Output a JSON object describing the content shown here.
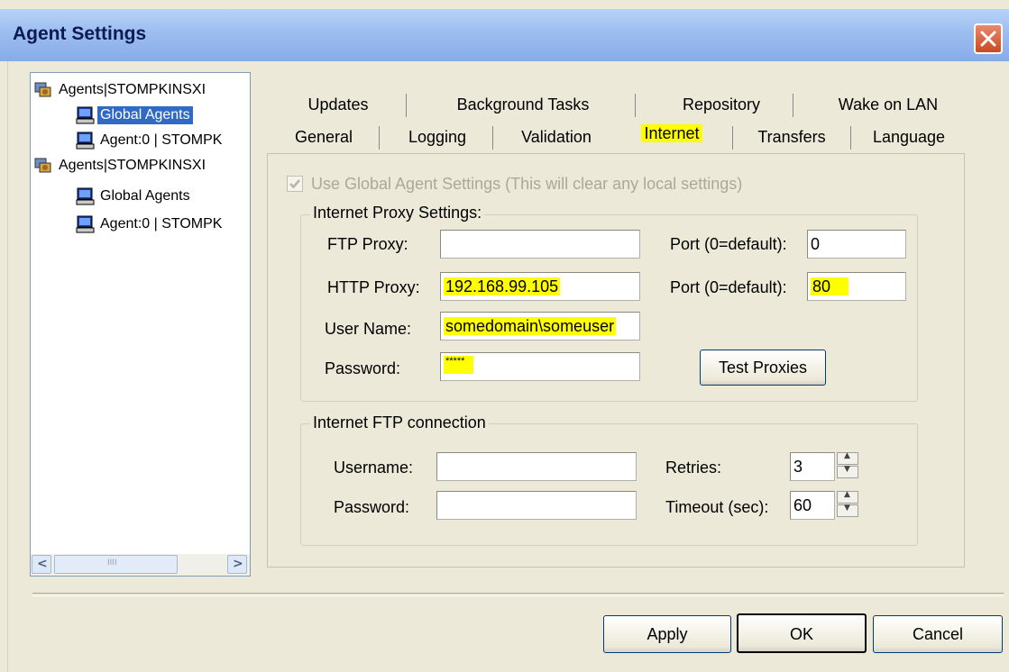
{
  "window": {
    "title": "Agent Settings",
    "close_icon": "close-icon"
  },
  "tree": {
    "nodes": [
      {
        "label": "Agents|STOMPKINSXI",
        "icon": "agents-group-icon",
        "level": 0,
        "selected": false
      },
      {
        "label": "Global Agents",
        "icon": "computer-icon",
        "level": 1,
        "selected": true
      },
      {
        "label": "Agent:0 | STOMPK",
        "icon": "computer-icon",
        "level": 1,
        "selected": false
      },
      {
        "label": "Agents|STOMPKINSXI",
        "icon": "agents-group-icon",
        "level": 0,
        "selected": false
      },
      {
        "label": "Global Agents",
        "icon": "computer-icon",
        "level": 1,
        "selected": false
      },
      {
        "label": "Agent:0 | STOMPK",
        "icon": "computer-icon",
        "level": 1,
        "selected": false
      }
    ],
    "scroll_left": "<",
    "scroll_right": ">",
    "scroll_thumb": "IIII"
  },
  "tabs": {
    "row1": [
      "Updates",
      "Background Tasks",
      "Repository",
      "Wake on LAN"
    ],
    "row2": [
      "General",
      "Logging",
      "Validation",
      "Internet",
      "Transfers",
      "Language"
    ],
    "active": "Internet"
  },
  "internet": {
    "use_global_label": "Use Global Agent Settings (This will clear any local settings)",
    "use_global_checked": true,
    "proxy_group_title": "Internet Proxy Settings:",
    "ftp_proxy_label": "FTP Proxy:",
    "ftp_proxy_value": "",
    "ftp_port_label": "Port (0=default):",
    "ftp_port_value": "0",
    "http_proxy_label": "HTTP Proxy:",
    "http_proxy_value": "192.168.99.105",
    "http_port_label": "Port (0=default):",
    "http_port_value": "80",
    "username_label": "User Name:",
    "username_value": "somedomain\\someuser",
    "password_label": "Password:",
    "password_value": "*****",
    "test_proxies_label": "Test Proxies",
    "ftp_group_title": "Internet FTP connection",
    "ftp_username_label": "Username:",
    "ftp_username_value": "",
    "ftp_password_label": "Password:",
    "ftp_password_value": "",
    "retries_label": "Retries:",
    "retries_value": "3",
    "timeout_label": "Timeout (sec):",
    "timeout_value": "60"
  },
  "buttons": {
    "apply": "Apply",
    "ok": "OK",
    "cancel": "Cancel"
  },
  "colors": {
    "title_bar": "#9cbdf0",
    "highlight": "#ffff00",
    "selection": "#316ac5",
    "close_button": "#d85a33"
  }
}
